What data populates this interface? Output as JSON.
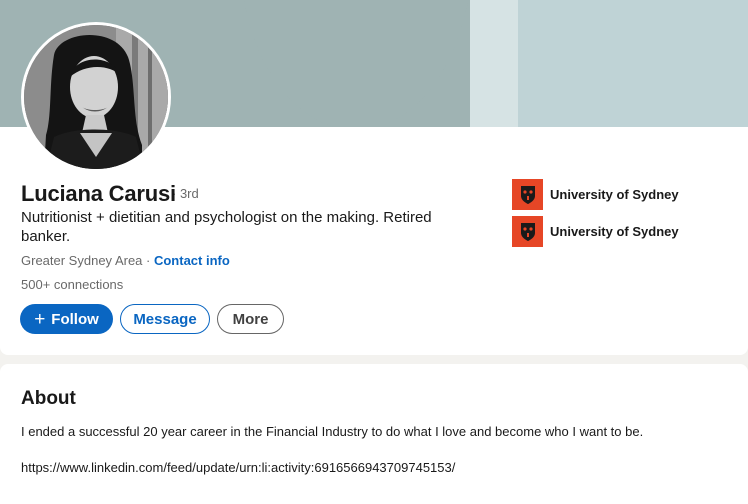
{
  "profile": {
    "name": "Luciana Carusi",
    "degree": "· 3rd",
    "headline": "Nutritionist + dietitian and psychologist on the making. Retired banker.",
    "location": "Greater Sydney Area",
    "location_separator": " · ",
    "contact_info": "Contact info",
    "connections": "500+ connections"
  },
  "actions": {
    "follow_icon": "+",
    "follow": "Follow",
    "message": "Message",
    "more": "More"
  },
  "education": [
    {
      "name": "University of Sydney",
      "logo": "university-of-sydney-logo"
    },
    {
      "name": "University of Sydney",
      "logo": "university-of-sydney-logo"
    }
  ],
  "about": {
    "title": "About",
    "text": "I ended a successful 20 year career in the Financial Industry to do what I love and become who I want to be.",
    "link": "https://www.linkedin.com/feed/update/urn:li:activity:6916566943709745153/"
  },
  "colors": {
    "accent": "#0a66c2",
    "university_red": "#e64626",
    "cover": "#9fb3b3"
  }
}
